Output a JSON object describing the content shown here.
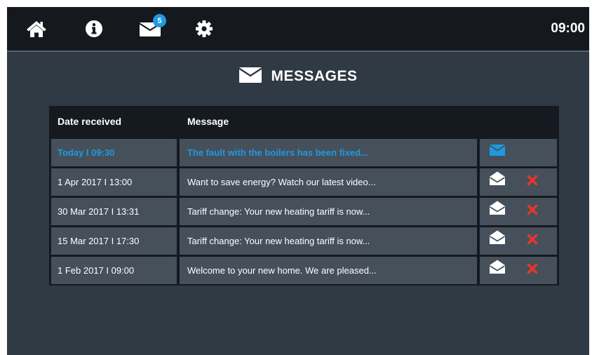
{
  "header": {
    "clock": "09:00",
    "unread_badge": "5"
  },
  "page": {
    "title": "MESSAGES"
  },
  "table": {
    "columns": {
      "date": "Date received",
      "message": "Message"
    },
    "rows": [
      {
        "date": "Today I 09:30",
        "message": "The fault with the boilers has been fixed...",
        "status": "unread"
      },
      {
        "date": "1 Apr 2017 I 13:00",
        "message": "Want to save energy? Watch our latest video...",
        "status": "read"
      },
      {
        "date": "30 Mar 2017 I 13:31",
        "message": "Tariff change: Your new heating tariff is now...",
        "status": "read"
      },
      {
        "date": "15 Mar 2017 I 17:30",
        "message": "Tariff change: Your new heating tariff is now...",
        "status": "read"
      },
      {
        "date": "1 Feb 2017 I 09:00",
        "message": "Welcome to your new home. We are pleased...",
        "status": "read"
      }
    ]
  },
  "icons": {
    "home": "home-icon",
    "info": "info-icon",
    "messages": "envelope-icon",
    "settings": "gear-icon",
    "unread": "envelope-closed-icon",
    "read": "envelope-open-icon",
    "delete": "delete-x-icon"
  },
  "colors": {
    "topbar": "#15191e",
    "background": "#2f3a45",
    "table_bg": "#151a20",
    "cell_bg": "#46505b",
    "accent_blue": "#1e9ae0",
    "delete_red": "#e8352b",
    "text": "#ffffff"
  }
}
